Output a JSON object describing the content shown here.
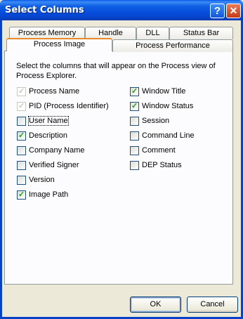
{
  "window": {
    "title": "Select Columns",
    "help_symbol": "?",
    "close_symbol": "✕"
  },
  "tabs": {
    "row_back": [
      {
        "label": "Process Memory"
      },
      {
        "label": "Handle"
      },
      {
        "label": "DLL"
      },
      {
        "label": "Status Bar"
      }
    ],
    "row_front": [
      {
        "label": "Process Image",
        "active": true
      },
      {
        "label": "Process Performance",
        "active": false
      }
    ]
  },
  "panel": {
    "instructions": "Select the columns that will appear on the Process view of Process Explorer.",
    "left_column": [
      {
        "label": "Process Name",
        "checked": true,
        "disabled": true
      },
      {
        "label": "PID (Process Identifier)",
        "checked": true,
        "disabled": true
      },
      {
        "label": "User Name",
        "checked": false,
        "disabled": false,
        "focused": true
      },
      {
        "label": "Description",
        "checked": true,
        "disabled": false
      },
      {
        "label": "Company Name",
        "checked": false,
        "disabled": false
      },
      {
        "label": "Verified Signer",
        "checked": false,
        "disabled": false
      },
      {
        "label": "Version",
        "checked": false,
        "disabled": false
      },
      {
        "label": "Image Path",
        "checked": true,
        "disabled": false
      }
    ],
    "right_column": [
      {
        "label": "Window Title",
        "checked": true,
        "disabled": false
      },
      {
        "label": "Window Status",
        "checked": true,
        "disabled": false
      },
      {
        "label": "Session",
        "checked": false,
        "disabled": false
      },
      {
        "label": "Command Line",
        "checked": false,
        "disabled": false
      },
      {
        "label": "Comment",
        "checked": false,
        "disabled": false
      },
      {
        "label": "DEP Status",
        "checked": false,
        "disabled": false
      }
    ]
  },
  "buttons": {
    "ok": "OK",
    "cancel": "Cancel"
  },
  "colors": {
    "titlebar": "#0549d8",
    "check_mark": "#21a121",
    "active_tab_accent": "#e68b2c"
  },
  "icons": {
    "checkbox_mark": "✓"
  }
}
